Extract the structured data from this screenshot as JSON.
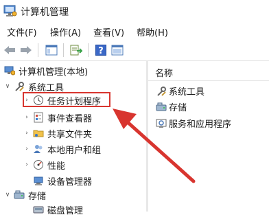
{
  "window": {
    "title": "计算机管理"
  },
  "menu": [
    "文件(F)",
    "操作(A)",
    "查看(V)",
    "帮助(H)"
  ],
  "toolbar": {
    "icons": [
      "back-arrow-icon",
      "forward-arrow-icon",
      "show-tree-icon",
      "export-list-icon",
      "help-icon",
      "properties-icon"
    ]
  },
  "tree": {
    "root": "计算机管理(本地)",
    "system_tools": "系统工具",
    "task_scheduler": "任务计划程序",
    "event_viewer": "事件查看器",
    "shared_folders": "共享文件夹",
    "local_users": "本地用户和组",
    "performance": "性能",
    "device_manager": "设备管理器",
    "storage": "存储",
    "disk_management": "磁盘管理"
  },
  "right_panel": {
    "header": "名称",
    "items": [
      "系统工具",
      "存储",
      "服务和应用程序"
    ]
  },
  "annotation": {
    "highlight_color": "#d8352f",
    "arrow_color": "#d8352f"
  }
}
